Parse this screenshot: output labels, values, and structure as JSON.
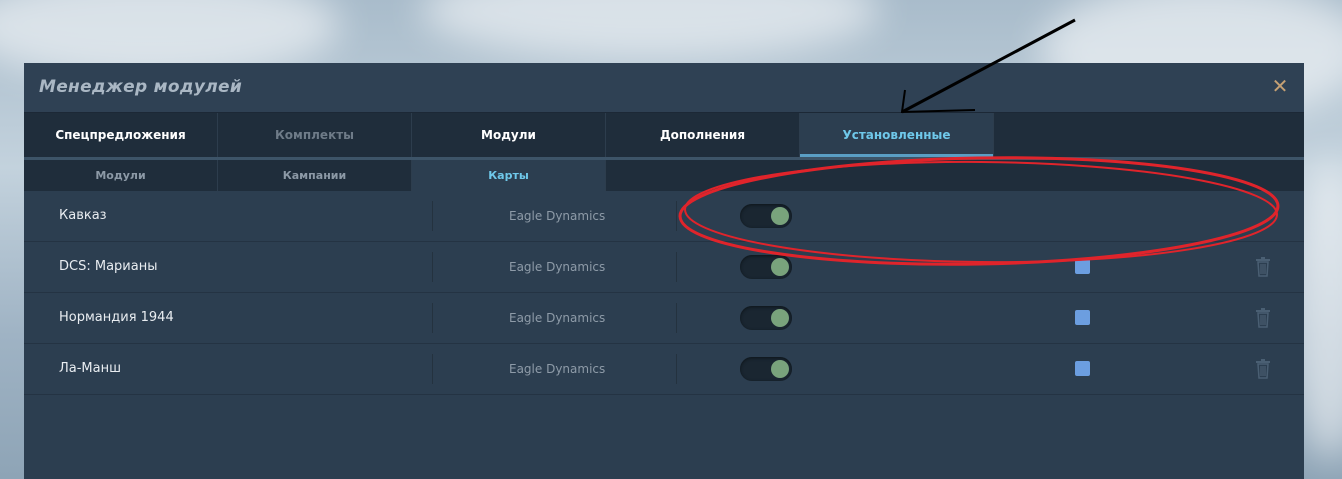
{
  "window": {
    "title": "Менеджер модулей",
    "close_icon": "close-icon"
  },
  "tabs": [
    {
      "label": "Спецпредложения",
      "state": "normal"
    },
    {
      "label": "Комплекты",
      "state": "disabled"
    },
    {
      "label": "Модули",
      "state": "normal"
    },
    {
      "label": "Дополнения",
      "state": "normal"
    },
    {
      "label": "Установленные",
      "state": "active"
    }
  ],
  "subtabs": [
    {
      "label": "Модули",
      "state": "normal"
    },
    {
      "label": "Кампании",
      "state": "normal"
    },
    {
      "label": "Карты",
      "state": "active"
    }
  ],
  "rows": [
    {
      "name": "Кавказ",
      "developer": "Eagle Dynamics",
      "enabled": true,
      "has_checkbox": false,
      "has_delete": false
    },
    {
      "name": "DCS: Марианы",
      "developer": "Eagle Dynamics",
      "enabled": true,
      "has_checkbox": true,
      "has_delete": true
    },
    {
      "name": "Нормандия 1944",
      "developer": "Eagle Dynamics",
      "enabled": true,
      "has_checkbox": true,
      "has_delete": true
    },
    {
      "name": "Ла-Манш",
      "developer": "Eagle Dynamics",
      "enabled": true,
      "has_checkbox": true,
      "has_delete": true
    }
  ],
  "colors": {
    "accent": "#6fc8ea",
    "toggle_on": "#79a37c",
    "checkbox": "#6c9ee0",
    "annotation_ellipse": "#e0242b",
    "annotation_arrow": "#000000"
  }
}
